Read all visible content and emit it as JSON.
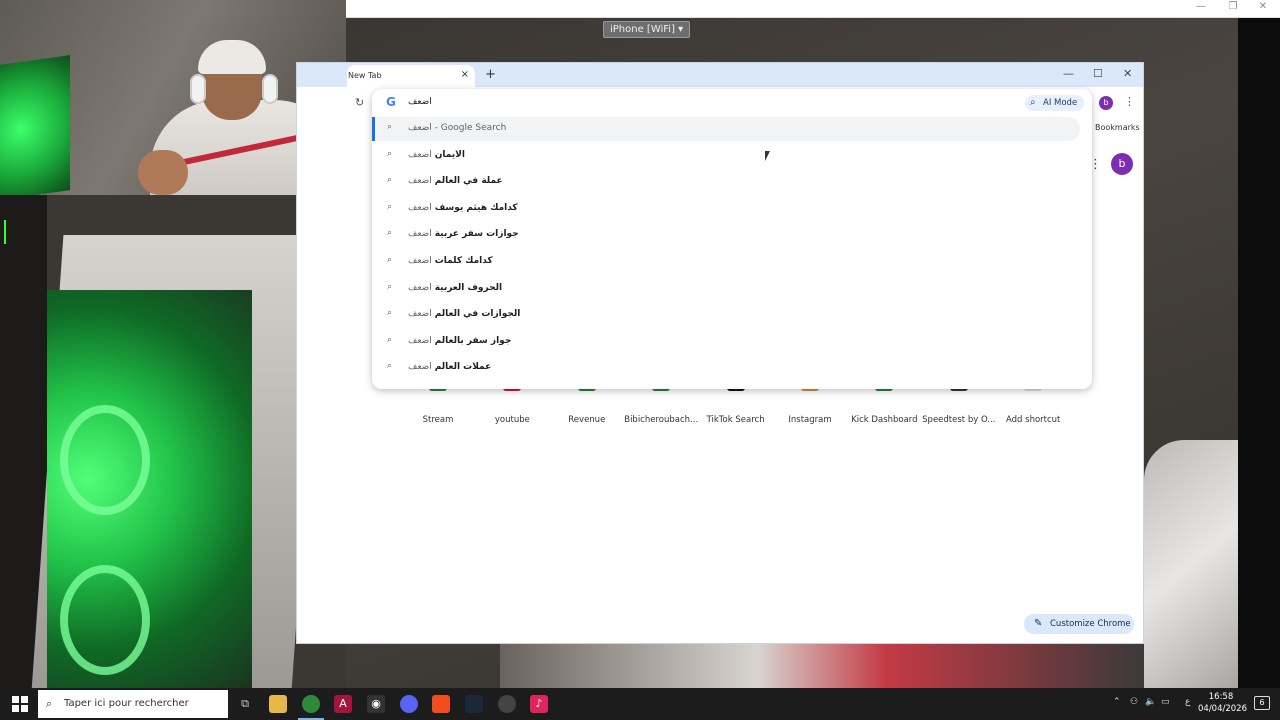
{
  "device_selector": "iPhone [WiFi]",
  "chrome": {
    "tab_title": "New Tab",
    "tab_close": "×",
    "new_tab": "+",
    "window_min": "—",
    "window_max": "☐",
    "window_close": "✕",
    "bookmarks_label": "Bookmarks",
    "avatar_letter": "b",
    "omnibox": {
      "query": "اضعف",
      "ai_mode_label": "AI Mode",
      "avatar_letter": "b",
      "suggestions": [
        {
          "base": "اضعف",
          "bold": "",
          "suffix": " - Google Search",
          "selected": true
        },
        {
          "base": "اضعف",
          "bold": "الايمان",
          "suffix": "",
          "selected": false
        },
        {
          "base": "اضعف",
          "bold": "عملة في العالم",
          "suffix": "",
          "selected": false
        },
        {
          "base": "اضعف",
          "bold": "كدامك هيثم يوسف",
          "suffix": "",
          "selected": false
        },
        {
          "base": "اضعف",
          "bold": "جوازات سفر عربية",
          "suffix": "",
          "selected": false
        },
        {
          "base": "اضعف",
          "bold": "كدامك كلمات",
          "suffix": "",
          "selected": false
        },
        {
          "base": "اضعف",
          "bold": "الحروف العربية",
          "suffix": "",
          "selected": false
        },
        {
          "base": "اضعف",
          "bold": "الجوازات في العالم",
          "suffix": "",
          "selected": false
        },
        {
          "base": "اضعف",
          "bold": "جواز سفر بالعالم",
          "suffix": "",
          "selected": false
        },
        {
          "base": "اضعف",
          "bold": "عملات العالم",
          "suffix": "",
          "selected": false
        }
      ]
    },
    "shortcuts": [
      {
        "label": "Stream",
        "color": "#1f8a2a"
      },
      {
        "label": "youtube",
        "color": "#e0102b"
      },
      {
        "label": "Revenue",
        "color": "#1f8a2a"
      },
      {
        "label": "Bibicheroubach...",
        "color": "#1f8a2a"
      },
      {
        "label": "TikTok Search",
        "color": "#111111"
      },
      {
        "label": "Instagram",
        "color": "#e8833a"
      },
      {
        "label": "Kick Dashboard",
        "color": "#1f8a2a"
      },
      {
        "label": "Speedtest by O...",
        "color": "#333333"
      },
      {
        "label": "Add shortcut",
        "color": "#dddddd"
      }
    ],
    "customize_label": "Customize Chrome"
  },
  "taskbar": {
    "search_placeholder": "Taper ici pour rechercher",
    "time": "16:58",
    "date": "04/04/2026",
    "notification_count": "6",
    "lang_indicator": "ع"
  }
}
